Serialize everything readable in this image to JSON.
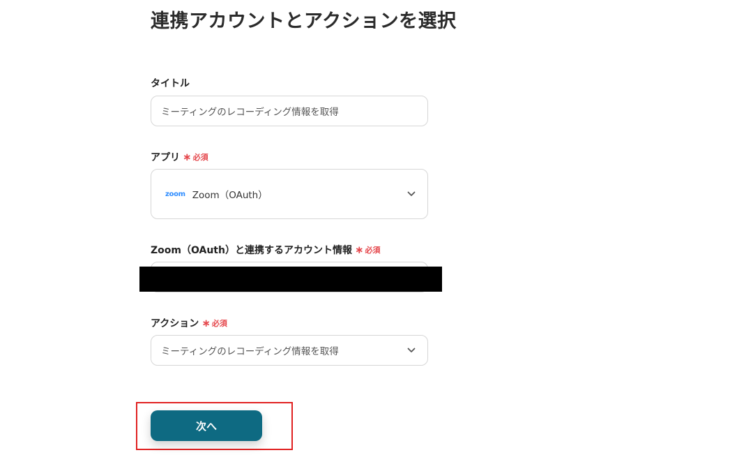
{
  "header": {
    "title": "連携アカウントとアクションを選択"
  },
  "form": {
    "title_field": {
      "label": "タイトル",
      "value": "ミーティングのレコーディング情報を取得"
    },
    "app_field": {
      "label": "アプリ",
      "required_text": "必須",
      "logo_text": "zoom",
      "value": "Zoom（OAuth）",
      "icon": "chevron-down-icon"
    },
    "account_field": {
      "label": "Zoom（OAuth）と連携するアカウント情報",
      "required_text": "必須"
    },
    "action_field": {
      "label": "アクション",
      "required_text": "必須",
      "value": "ミーティングのレコーディング情報を取得",
      "icon": "chevron-down-icon"
    }
  },
  "footer": {
    "next_label": "次へ"
  },
  "colors": {
    "accent": "#0e6a82",
    "required": "#e5484d",
    "highlight": "#e02020",
    "zoom_brand": "#2d8cff"
  }
}
